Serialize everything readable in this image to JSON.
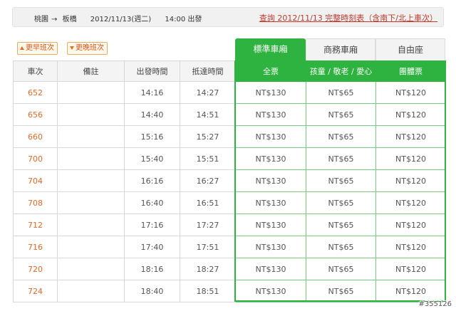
{
  "trip": {
    "from": "桃園",
    "arrow": "→",
    "to": "板橋",
    "date": "2012/11/13(週二)",
    "time": "14:00 出發",
    "link": "查詢 2012/11/13 完整時刻表（含南下/北上車次）"
  },
  "buttons": {
    "earlier": "更早班次",
    "later": "更晚班次"
  },
  "tabs": {
    "standard": "標準車廂",
    "business": "商務車廂",
    "free": "自由座"
  },
  "columns": [
    "車次",
    "備註",
    "出發時間",
    "抵達時間",
    "全票",
    "孩童 / 敬老 / 愛心",
    "團體票"
  ],
  "rows": [
    {
      "no": "652",
      "note": "",
      "dep": "14:16",
      "arr": "14:27",
      "full": "NT$130",
      "child": "NT$65",
      "group": "NT$120"
    },
    {
      "no": "656",
      "note": "",
      "dep": "14:40",
      "arr": "14:51",
      "full": "NT$130",
      "child": "NT$65",
      "group": "NT$120"
    },
    {
      "no": "660",
      "note": "",
      "dep": "15:16",
      "arr": "15:27",
      "full": "NT$130",
      "child": "NT$65",
      "group": "NT$120"
    },
    {
      "no": "700",
      "note": "",
      "dep": "15:40",
      "arr": "15:51",
      "full": "NT$130",
      "child": "NT$65",
      "group": "NT$120"
    },
    {
      "no": "704",
      "note": "",
      "dep": "16:16",
      "arr": "16:27",
      "full": "NT$130",
      "child": "NT$65",
      "group": "NT$120"
    },
    {
      "no": "708",
      "note": "",
      "dep": "16:40",
      "arr": "16:51",
      "full": "NT$130",
      "child": "NT$65",
      "group": "NT$120"
    },
    {
      "no": "712",
      "note": "",
      "dep": "17:16",
      "arr": "17:27",
      "full": "NT$130",
      "child": "NT$65",
      "group": "NT$120"
    },
    {
      "no": "716",
      "note": "",
      "dep": "17:40",
      "arr": "17:51",
      "full": "NT$130",
      "child": "NT$65",
      "group": "NT$120"
    },
    {
      "no": "720",
      "note": "",
      "dep": "18:16",
      "arr": "18:27",
      "full": "NT$130",
      "child": "NT$65",
      "group": "NT$120"
    },
    {
      "no": "724",
      "note": "",
      "dep": "18:40",
      "arr": "18:51",
      "full": "NT$130",
      "child": "NT$65",
      "group": "NT$120"
    }
  ],
  "watermark": "#355126",
  "colors": {
    "accent_green": "#2fb340",
    "train_number": "#e06a2a",
    "link_red": "#c0392b"
  }
}
